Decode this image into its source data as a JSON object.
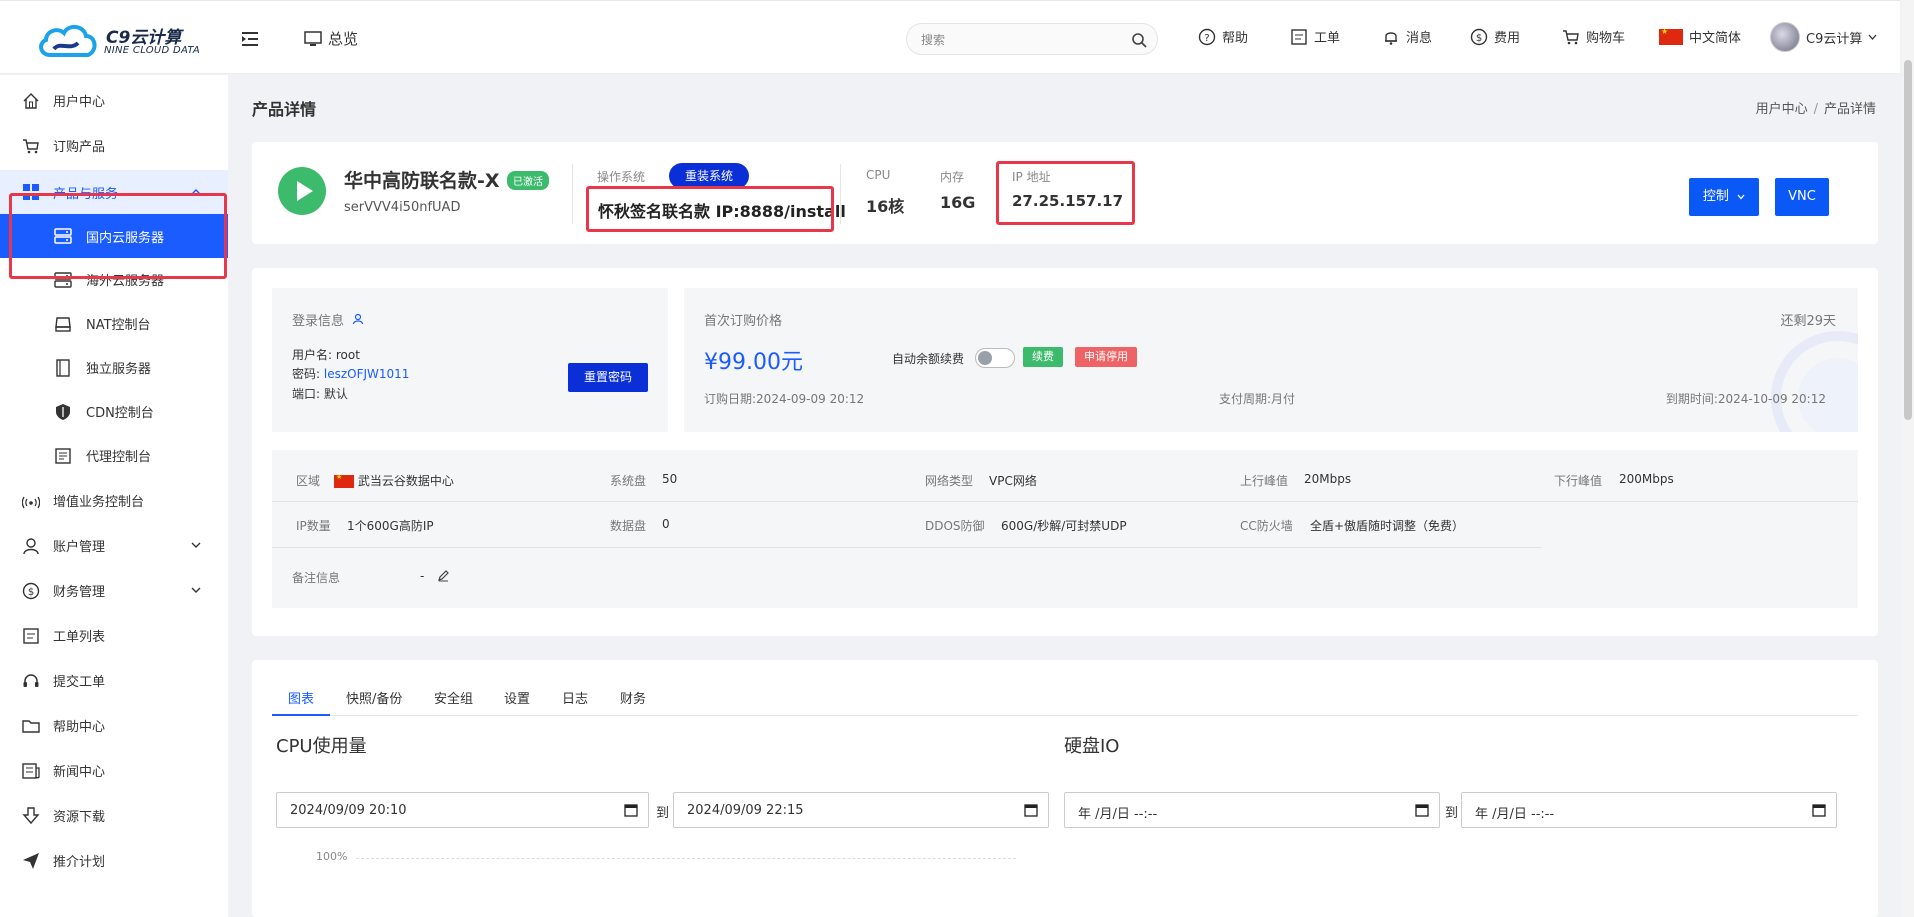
{
  "header": {
    "logo_title": "C9云计算",
    "logo_subtitle": "NINE CLOUD DATA",
    "overview": "总览",
    "search_placeholder": "搜索",
    "nav": {
      "help": "帮助",
      "ticket": "工单",
      "message": "消息",
      "fee": "费用",
      "cart": "购物车",
      "language": "中文简体",
      "user": "C9云计算"
    }
  },
  "sidebar": {
    "items": [
      {
        "label": "用户中心",
        "icon": "home-icon"
      },
      {
        "label": "订购产品",
        "icon": "cart-icon"
      },
      {
        "label": "产品与服务",
        "icon": "grid-icon"
      },
      {
        "label": "国内云服务器",
        "icon": "server-icon"
      },
      {
        "label": "海外云服务器",
        "icon": "server-icon"
      },
      {
        "label": "NAT控制台",
        "icon": "hdd-icon"
      },
      {
        "label": "独立服务器",
        "icon": "book-icon"
      },
      {
        "label": "CDN控制台",
        "icon": "shield-icon"
      },
      {
        "label": "代理控制台",
        "icon": "list-icon"
      },
      {
        "label": "增值业务控制台",
        "icon": "signal-icon"
      },
      {
        "label": "账户管理",
        "icon": "user-icon"
      },
      {
        "label": "财务管理",
        "icon": "dollar-icon"
      },
      {
        "label": "工单列表",
        "icon": "ticket-icon"
      },
      {
        "label": "提交工单",
        "icon": "headset-icon"
      },
      {
        "label": "帮助中心",
        "icon": "folder-icon"
      },
      {
        "label": "新闻中心",
        "icon": "news-icon"
      },
      {
        "label": "资源下载",
        "icon": "download-icon"
      },
      {
        "label": "推介计划",
        "icon": "send-icon"
      }
    ]
  },
  "page": {
    "title": "产品详情",
    "breadcrumb": [
      "用户中心",
      "产品详情"
    ]
  },
  "product": {
    "name": "华中高防联名款-X",
    "status": "已激活",
    "id": "serVVV4i50nfUAD",
    "os_label": "操作系统",
    "reinstall": "重装系统",
    "os_value": "怀秋签名联名款 IP:8888/install",
    "cpu_label": "CPU",
    "cpu_value": "16核",
    "mem_label": "内存",
    "mem_value": "16G",
    "ip_label": "IP 地址",
    "ip_value": "27.25.157.17",
    "control": "控制",
    "vnc": "VNC"
  },
  "login": {
    "title": "登录信息",
    "username_label": "用户名:",
    "username": "root",
    "password_label": "密码:",
    "password": "leszOFJW1011",
    "port_label": "端口:",
    "port": "默认",
    "reset": "重置密码"
  },
  "billing": {
    "first_price_label": "首次订购价格",
    "remaining": "还剩29天",
    "price": "¥99.00元",
    "auto_renew": "自动余额续费",
    "auto_renew_on": false,
    "renew": "续费",
    "cancel": "申请停用",
    "order_date": "订购日期:2024-09-09 20:12",
    "pay_cycle": "支付周期:月付",
    "expire": "到期时间:2024-10-09 20:12"
  },
  "specs": {
    "region_label": "区域",
    "region": "武当云谷数据中心",
    "sys_disk_label": "系统盘",
    "sys_disk": "50",
    "net_type_label": "网络类型",
    "net_type": "VPC网络",
    "up_label": "上行峰值",
    "up": "20Mbps",
    "down_label": "下行峰值",
    "down": "200Mbps",
    "ip_count_label": "IP数量",
    "ip_count": "1个600G高防IP",
    "data_disk_label": "数据盘",
    "data_disk": "0",
    "ddos_label": "DDOS防御",
    "ddos": "600G/秒解/可封禁UDP",
    "cc_label": "CC防火墙",
    "cc": "全盾+傲盾随时调整（免费）",
    "remark_label": "备注信息",
    "remark": "-"
  },
  "tabs": [
    "图表",
    "快照/备份",
    "安全组",
    "设置",
    "日志",
    "财务"
  ],
  "charts": {
    "cpu_title": "CPU使用量",
    "disk_title": "硬盘IO",
    "cpu_from": "2024/09/09 20:10",
    "cpu_to": "2024/09/09 22:15",
    "disk_from": "年 /月/日 --:--",
    "disk_to": "年 /月/日 --:--",
    "to_label": "到",
    "y_top": "100%"
  }
}
